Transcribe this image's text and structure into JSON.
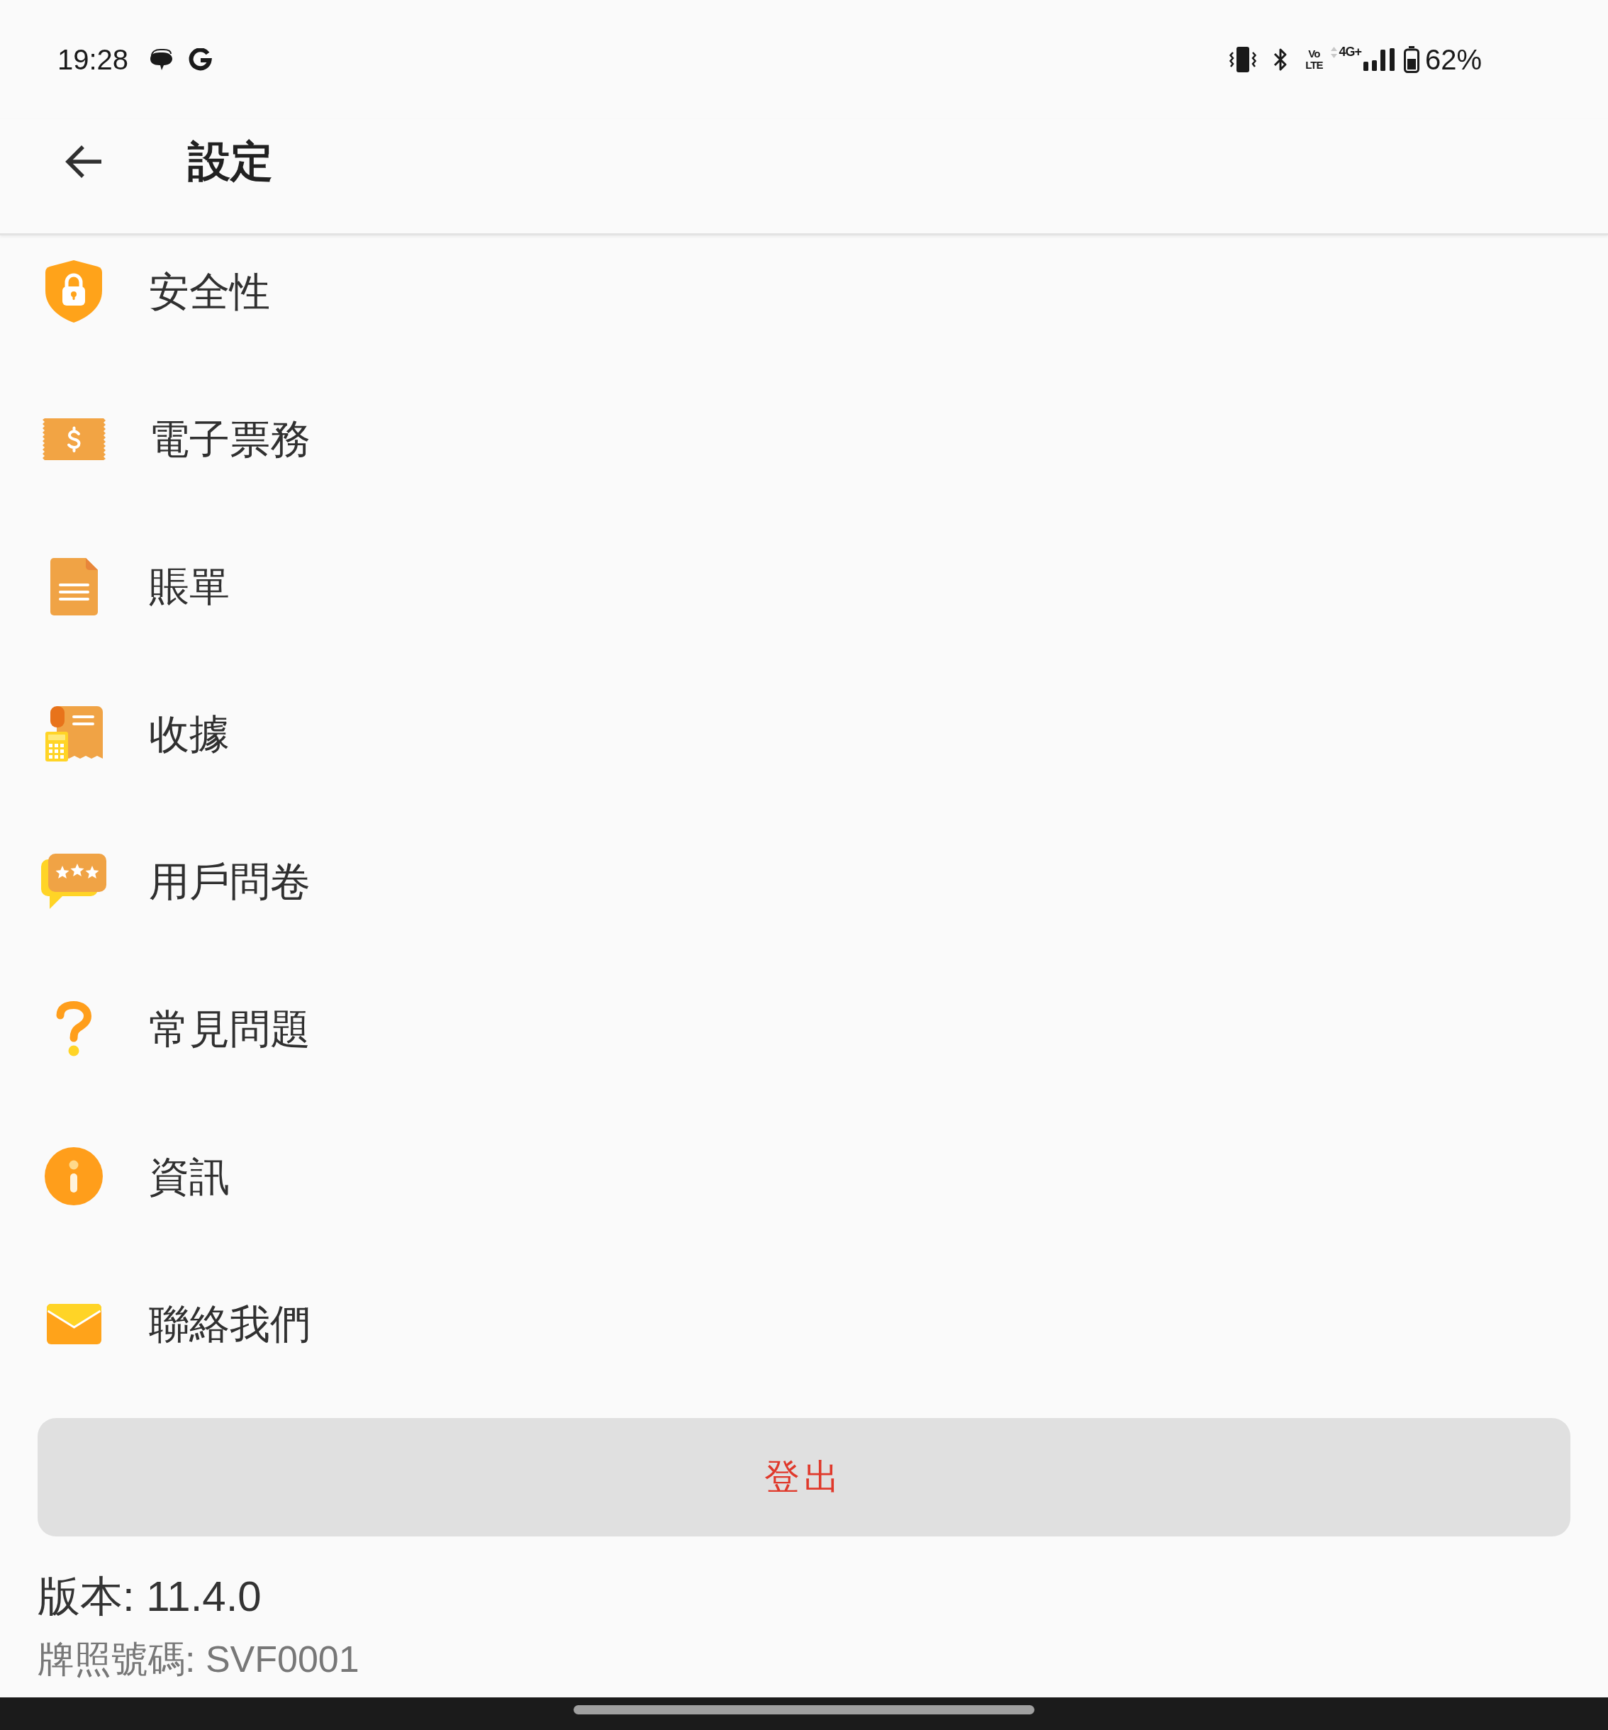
{
  "status_bar": {
    "time": "19:28",
    "volte_lines": [
      "Vo",
      "LTE"
    ],
    "network_type": "4G+",
    "battery": "62%"
  },
  "app_bar": {
    "title": "設定"
  },
  "menu_items": [
    {
      "label": "安全性"
    },
    {
      "label": "電子票務"
    },
    {
      "label": "賬單"
    },
    {
      "label": "收據"
    },
    {
      "label": "用戶問卷"
    },
    {
      "label": "常見問題"
    },
    {
      "label": "資訊"
    },
    {
      "label": "聯絡我們"
    }
  ],
  "logout_button": {
    "label": "登出"
  },
  "version": "版本: 11.4.0",
  "license_plate": "牌照號碼: SVF0001"
}
